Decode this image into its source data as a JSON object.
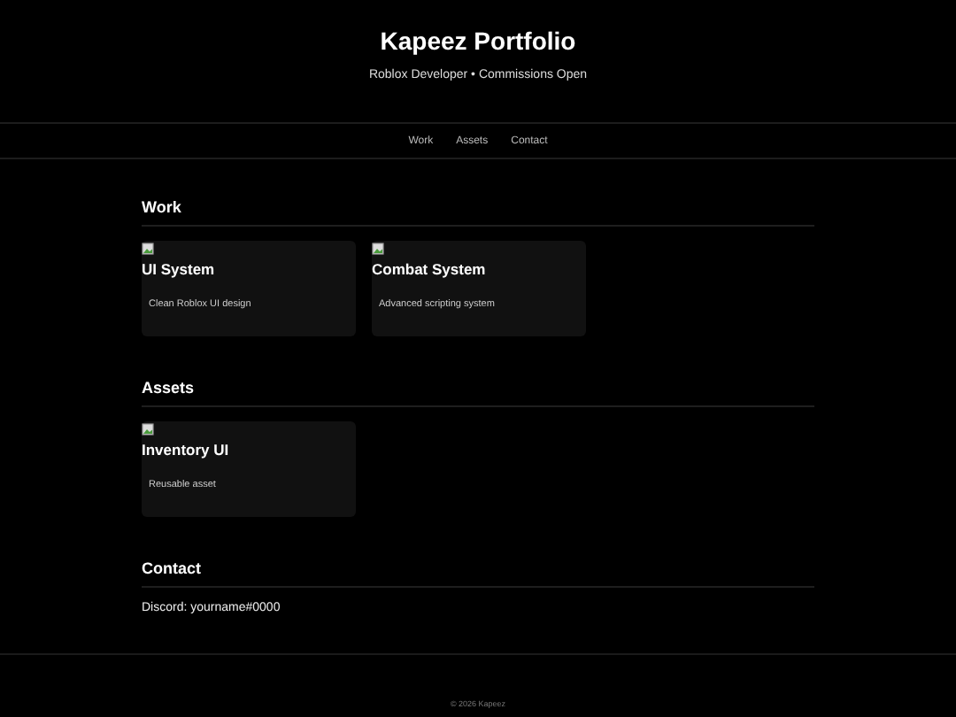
{
  "header": {
    "title": "Kapeez Portfolio",
    "subtitle": "Roblox Developer • Commissions Open"
  },
  "nav": [
    "Work",
    "Assets",
    "Contact"
  ],
  "sections": [
    {
      "kind": "cards",
      "title": "Work",
      "cards": [
        {
          "title": "UI System",
          "description": "Clean Roblox UI design"
        },
        {
          "title": "Combat System",
          "description": "Advanced scripting system"
        }
      ]
    },
    {
      "kind": "cards",
      "title": "Assets",
      "cards": [
        {
          "title": "Inventory UI",
          "description": "Reusable asset"
        }
      ]
    },
    {
      "kind": "text",
      "title": "Contact",
      "text": "Discord: yourname#0000"
    }
  ],
  "footer": "© 2026 Kapeez"
}
